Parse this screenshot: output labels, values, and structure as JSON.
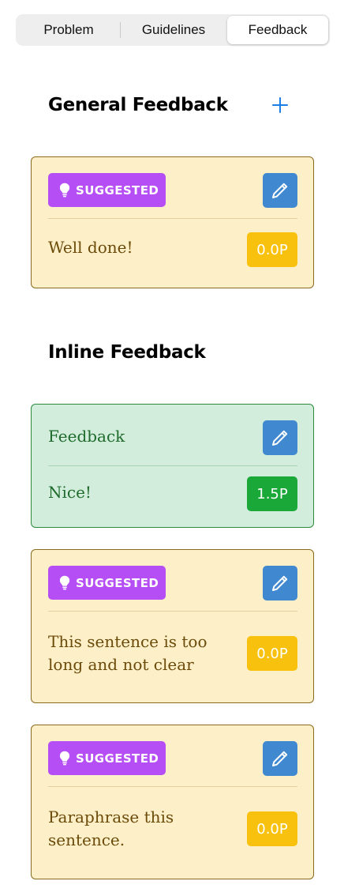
{
  "tabs": [
    {
      "label": "Problem",
      "selected": false
    },
    {
      "label": "Guidelines",
      "selected": false
    },
    {
      "label": "Feedback",
      "selected": true
    }
  ],
  "general": {
    "title": "General Feedback",
    "add_icon": "plus-icon",
    "items": [
      {
        "badge": "SUGGESTED",
        "text": "Well done!",
        "score": "0.0P",
        "status": "suggested"
      }
    ]
  },
  "inline": {
    "title": "Inline Feedback",
    "items": [
      {
        "label": "Feedback",
        "text": "Nice!",
        "score": "1.5P",
        "status": "approved"
      },
      {
        "badge": "SUGGESTED",
        "text_lines": [
          "This sentence is too",
          "long and not clear"
        ],
        "score": "0.0P",
        "status": "suggested"
      },
      {
        "badge": "SUGGESTED",
        "text_lines": [
          "Paraphrase this",
          "sentence."
        ],
        "score": "0.0P",
        "status": "suggested"
      }
    ]
  },
  "icons": {
    "badge_icon": "lightbulb-icon",
    "edit_icon": "pencil-icon"
  },
  "colors": {
    "accent": "#1a7ee6",
    "suggested_badge": "#b64ef6",
    "suggested_card_bg": "#fdf0c8",
    "approved_card_bg": "#d2eddb",
    "score_yellow": "#f7c10e",
    "score_green": "#1aa838",
    "edit_button": "#4088cf"
  }
}
